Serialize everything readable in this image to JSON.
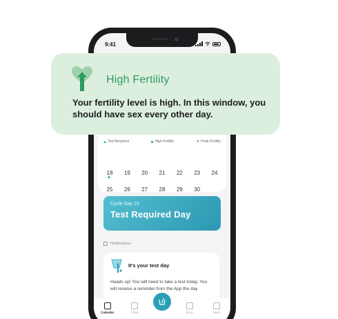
{
  "status_bar": {
    "time": "9:41"
  },
  "calendar": {
    "week_rows": [
      [
        "18",
        "19",
        "20",
        "21",
        "22",
        "23",
        "24"
      ],
      [
        "25",
        "26",
        "27",
        "28",
        "29",
        "30",
        ""
      ]
    ],
    "legend": {
      "test_required": "Test Required",
      "high_fertility": "High Fertility",
      "peak_fertility": "Peak Fertility"
    }
  },
  "cycle_card": {
    "subtitle": "Cycle Day 15",
    "title": "Test Required Day"
  },
  "notifications": {
    "header": "Notifications",
    "card_title": "It's your test day",
    "card_body": "Heads up! You will need to take a test today. You will receive a reminder from the App the day"
  },
  "tabbar": {
    "items": [
      {
        "label": "Calendar",
        "icon": "calendar-icon",
        "active": true
      },
      {
        "label": "Chart",
        "icon": "chart-icon",
        "active": false
      },
      {
        "label": "",
        "icon": "test-icon",
        "active": false
      },
      {
        "label": "Shop",
        "icon": "shop-icon",
        "active": false
      },
      {
        "label": "More",
        "icon": "menu-icon",
        "active": false
      }
    ]
  },
  "popup": {
    "title": "High Fertility",
    "body": "Your fertility level is high. In this window, you should have sex every other day.",
    "icon": "heart-arrow-icon"
  },
  "colors": {
    "accent": "#2a9fb8",
    "fertility_green": "#2e9a5e",
    "popup_bg": "#dcefdf",
    "peak_purple": "#9a52c8"
  }
}
